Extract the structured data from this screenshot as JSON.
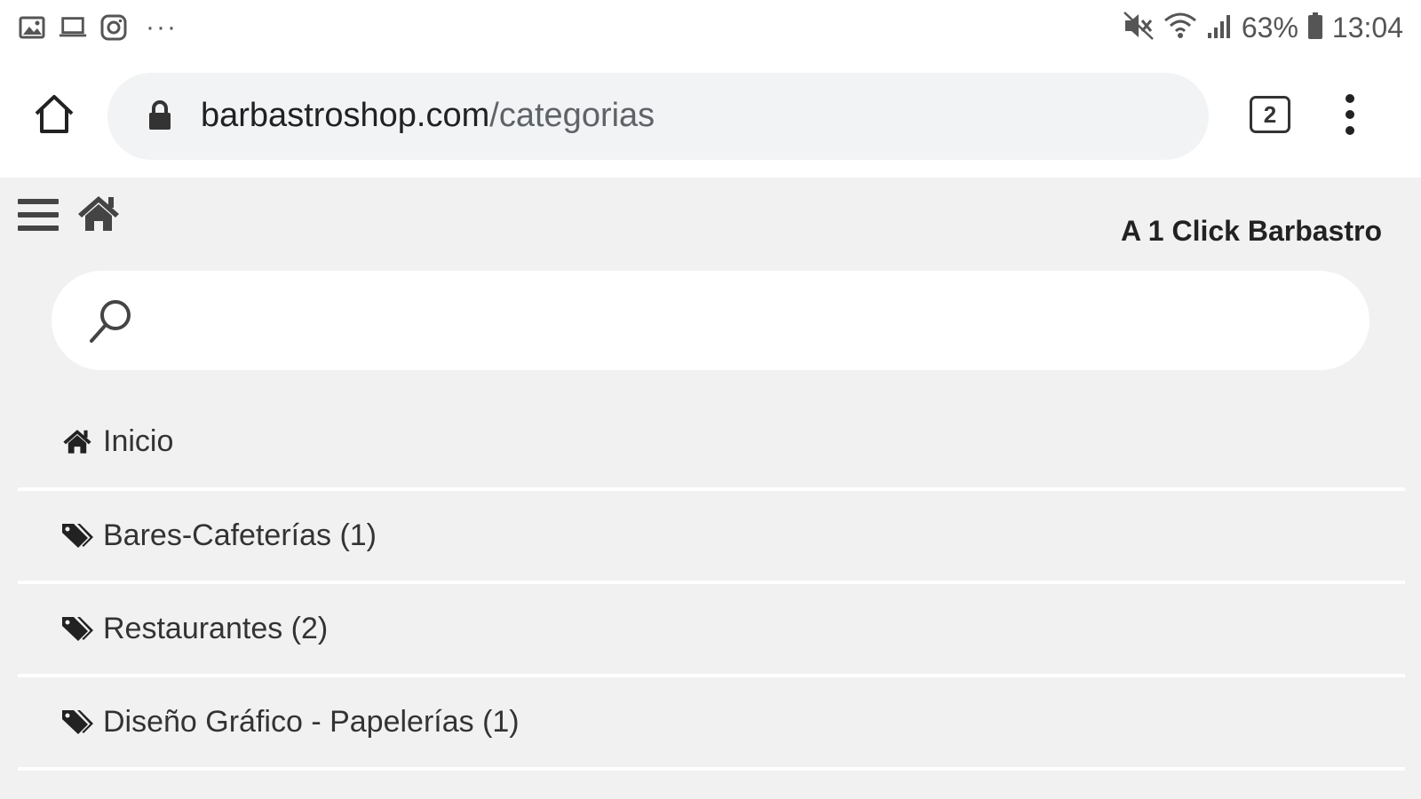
{
  "status_bar": {
    "left_icons": [
      "gallery-icon",
      "laptop-icon",
      "instagram-icon"
    ],
    "more": "···",
    "battery_percent": "63%",
    "time": "13:04",
    "right_icons": [
      "mute-icon",
      "wifi-icon",
      "signal-icon",
      "battery-icon"
    ]
  },
  "browser": {
    "url_host": "barbastroshop.com",
    "url_path": "/categorias",
    "tab_count": "2"
  },
  "site": {
    "brand": "A 1 Click Barbastro",
    "search_placeholder": ""
  },
  "nav": {
    "items": [
      {
        "label": "Inicio",
        "icon": "home-icon"
      },
      {
        "label": "Bares-Cafeterías (1)",
        "icon": "tags-icon"
      },
      {
        "label": "Restaurantes (2)",
        "icon": "tags-icon"
      },
      {
        "label": "Diseño Gráfico - Papelerías (1)",
        "icon": "tags-icon"
      }
    ]
  },
  "colors": {
    "page_bg": "#f1f1f1",
    "toolbar_bg": "#ffffff",
    "url_bar_bg": "#f1f3f4",
    "text": "#333333"
  }
}
